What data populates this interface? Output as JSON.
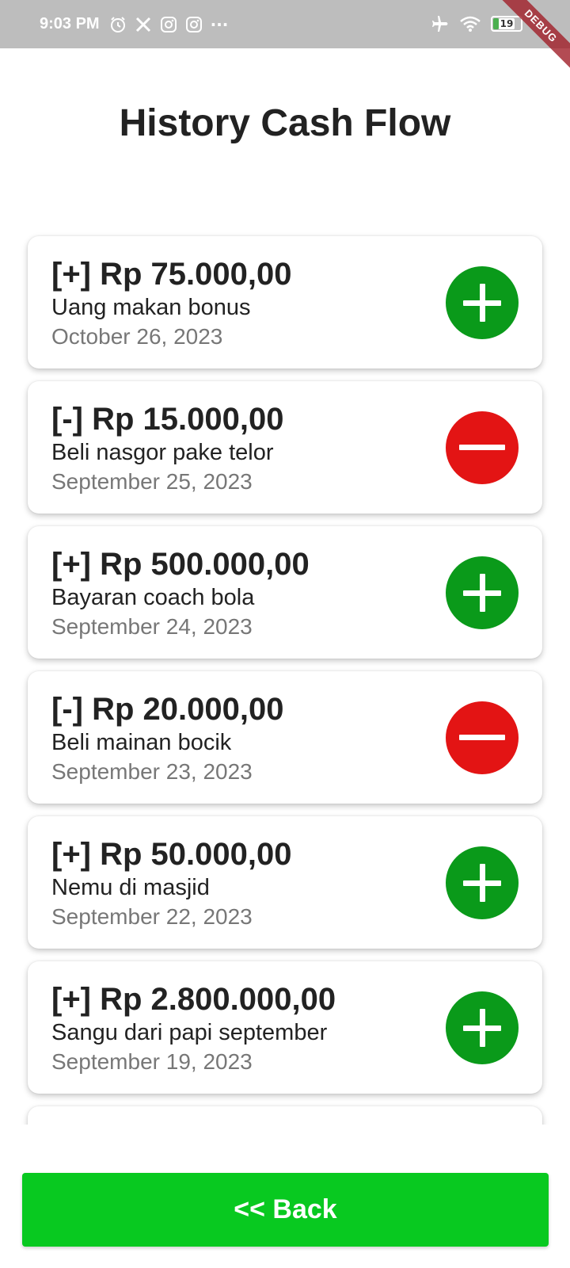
{
  "status_bar": {
    "time": "9:03 PM",
    "notification_icons": [
      "alarm-icon",
      "x-icon",
      "instagram-icon",
      "instagram-icon"
    ],
    "overflow": "···",
    "battery_level": "19",
    "right_icons": [
      "airplane-icon",
      "wifi-icon",
      "battery-icon"
    ]
  },
  "debug_banner": "DEBUG",
  "page": {
    "title": "History Cash Flow"
  },
  "colors": {
    "income": "#0a9a1a",
    "expense": "#e31414",
    "back_button": "#08c920"
  },
  "transactions": [
    {
      "amount": "[+] Rp 75.000,00",
      "description": "Uang makan bonus",
      "date": "October 26, 2023",
      "type": "income",
      "icon": "plus-icon"
    },
    {
      "amount": "[-] Rp 15.000,00",
      "description": "Beli nasgor pake telor",
      "date": "September 25, 2023",
      "type": "expense",
      "icon": "minus-icon"
    },
    {
      "amount": "[+] Rp 500.000,00",
      "description": "Bayaran coach bola",
      "date": "September 24, 2023",
      "type": "income",
      "icon": "plus-icon"
    },
    {
      "amount": "[-] Rp 20.000,00",
      "description": "Beli mainan bocik",
      "date": "September 23, 2023",
      "type": "expense",
      "icon": "minus-icon"
    },
    {
      "amount": "[+] Rp 50.000,00",
      "description": "Nemu di masjid",
      "date": "September 22, 2023",
      "type": "income",
      "icon": "plus-icon"
    },
    {
      "amount": "[+] Rp 2.800.000,00",
      "description": "Sangu dari papi september",
      "date": "September 19, 2023",
      "type": "income",
      "icon": "plus-icon"
    }
  ],
  "back_button": {
    "label": "<< Back"
  }
}
